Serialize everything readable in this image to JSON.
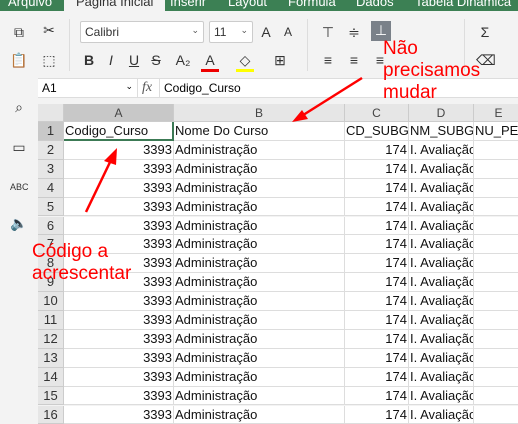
{
  "tabs": [
    "Arquivo",
    "Página Inicial",
    "Inserir",
    "Layout",
    "Fórmula",
    "Dados",
    "Tabela Dinâmica"
  ],
  "toolbar": {
    "font": "Calibri",
    "size": "11"
  },
  "formula_bar": {
    "cell_ref": "A1",
    "fx": "fx",
    "value": "Codigo_Curso"
  },
  "columns": [
    "A",
    "B",
    "C",
    "D",
    "E"
  ],
  "header_row": [
    "Codigo_Curso",
    "Nome Do Curso",
    "CD_SUBGR",
    "NM_SUBG",
    "NU_PER"
  ],
  "rows": [
    {
      "n": "1"
    },
    {
      "n": "2",
      "a": "3393",
      "b": "Administração",
      "c": "174",
      "d": "I. Avaliação"
    },
    {
      "n": "3",
      "a": "3393",
      "b": "Administração",
      "c": "174",
      "d": "I. Avaliação"
    },
    {
      "n": "4",
      "a": "3393",
      "b": "Administração",
      "c": "174",
      "d": "I. Avaliação"
    },
    {
      "n": "5",
      "a": "3393",
      "b": "Administração",
      "c": "174",
      "d": "I. Avaliação"
    },
    {
      "n": "6",
      "a": "3393",
      "b": "Administração",
      "c": "174",
      "d": "I. Avaliação"
    },
    {
      "n": "7",
      "a": "3393",
      "b": "Administração",
      "c": "174",
      "d": "I. Avaliação"
    },
    {
      "n": "8",
      "a": "3393",
      "b": "Administração",
      "c": "174",
      "d": "I. Avaliação"
    },
    {
      "n": "9",
      "a": "3393",
      "b": "Administração",
      "c": "174",
      "d": "I. Avaliação"
    },
    {
      "n": "10",
      "a": "3393",
      "b": "Administração",
      "c": "174",
      "d": "I. Avaliação"
    },
    {
      "n": "11",
      "a": "3393",
      "b": "Administração",
      "c": "174",
      "d": "I. Avaliação"
    },
    {
      "n": "12",
      "a": "3393",
      "b": "Administração",
      "c": "174",
      "d": "I. Avaliação"
    },
    {
      "n": "13",
      "a": "3393",
      "b": "Administração",
      "c": "174",
      "d": "I. Avaliação"
    },
    {
      "n": "14",
      "a": "3393",
      "b": "Administração",
      "c": "174",
      "d": "I. Avaliação"
    },
    {
      "n": "15",
      "a": "3393",
      "b": "Administração",
      "c": "174",
      "d": "I. Avaliação"
    },
    {
      "n": "16",
      "a": "3393",
      "b": "Administração",
      "c": "174",
      "d": "I. Avaliação"
    }
  ],
  "annotations": {
    "top": "Não\nprecisamos\nmudar",
    "left": "Código a\nacrescentar"
  },
  "colors": {
    "accent": "#3c8054",
    "annotation": "#ff0000"
  }
}
